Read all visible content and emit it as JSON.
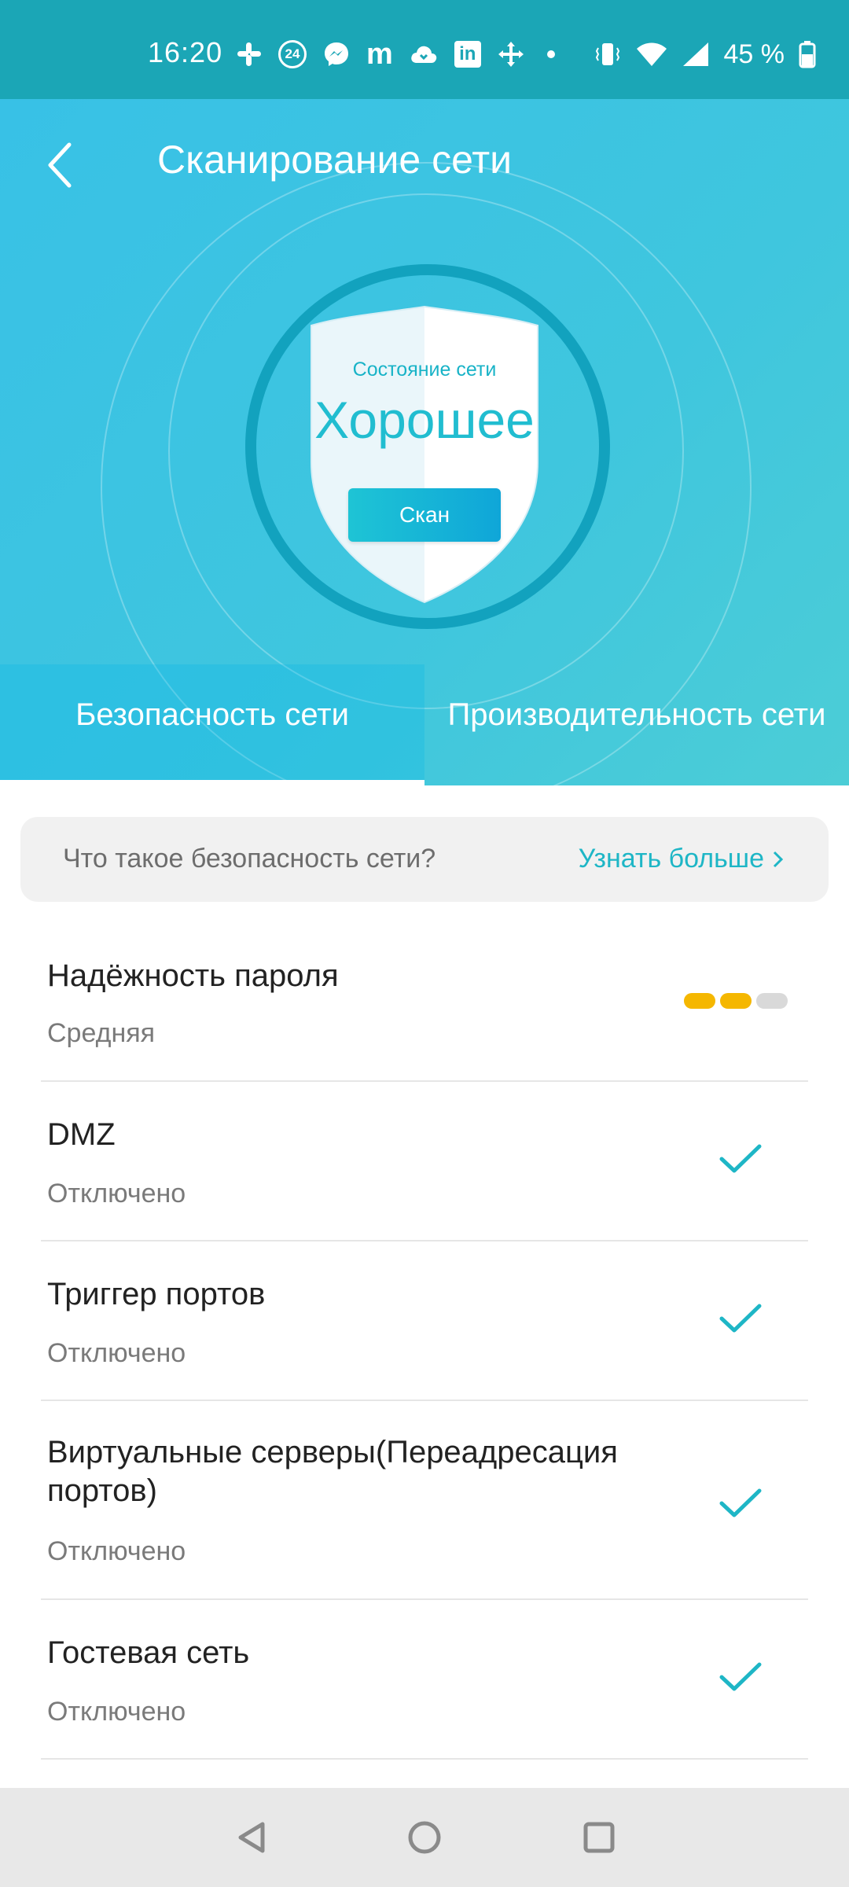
{
  "status_bar": {
    "time": "16:20",
    "notification_icons": [
      "slack-icon",
      "news24-icon",
      "messenger-icon",
      "m-app-icon",
      "cloud-icon",
      "linkedin-icon",
      "move-icon",
      "dot-icon"
    ],
    "badge_24": "24",
    "m_letter": "m",
    "linkedin_letters": "in",
    "battery_percent": "45 %"
  },
  "header": {
    "title": "Сканирование сети"
  },
  "shield": {
    "status_label": "Состояние сети",
    "status_value": "Хорошее",
    "scan_button": "Скан"
  },
  "tabs": [
    {
      "label": "Безопасность сети",
      "active": true
    },
    {
      "label": "Производительность сети",
      "active": false
    }
  ],
  "info": {
    "question": "Что такое безопасность сети?",
    "link": "Узнать больше"
  },
  "items": [
    {
      "title": "Надёжность пароля",
      "status": "Средняя",
      "indicator": "strength",
      "strength_level": 2,
      "strength_max": 3
    },
    {
      "title": "DMZ",
      "status": "Отключено",
      "indicator": "check"
    },
    {
      "title": "Триггер портов",
      "status": "Отключено",
      "indicator": "check"
    },
    {
      "title": "Виртуальные серверы(Переадресация портов)",
      "status": "Отключено",
      "indicator": "check"
    },
    {
      "title": "Гостевая сеть",
      "status": "Отключено",
      "indicator": "check"
    }
  ],
  "colors": {
    "accent": "#1eb6c6",
    "status_bar": "#1ba6b6",
    "strength_on": "#f5b700",
    "strength_off": "#d9d9d9"
  }
}
